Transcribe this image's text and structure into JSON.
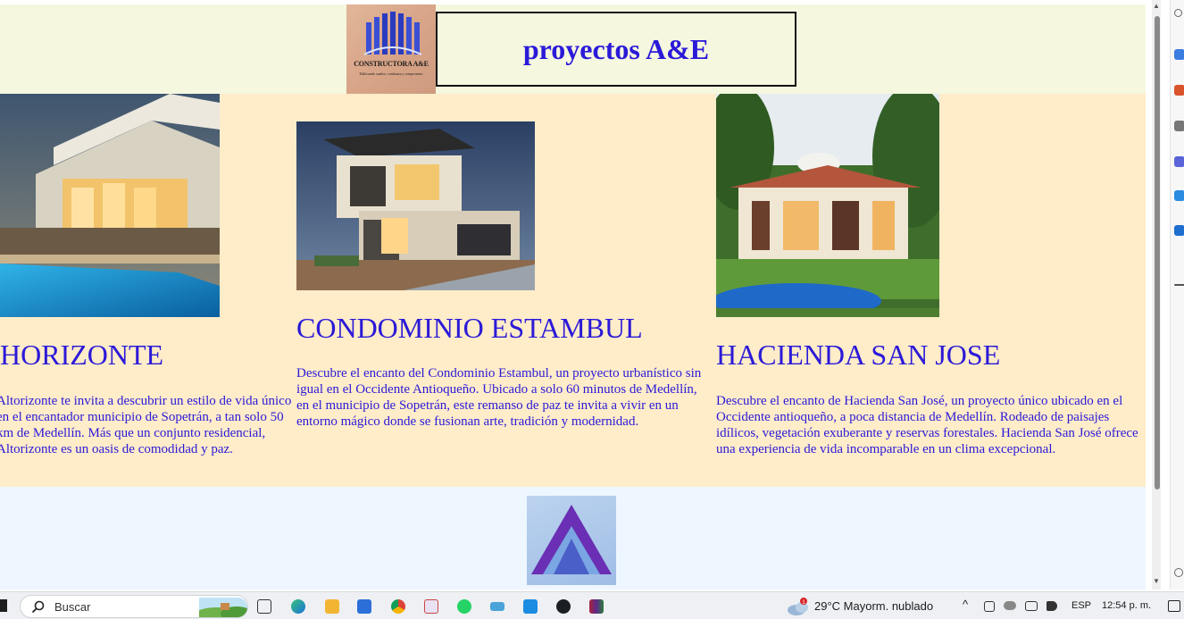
{
  "header": {
    "logo_name": "CONSTRUCTORA A&E",
    "logo_tagline": "Edificando sueños, confianza y compromiso",
    "title": "proyectos A&E"
  },
  "projects": [
    {
      "name": "HORIZONTE",
      "description": "Altorizonte te invita a descubrir un estilo de vida único en el encantador municipio de Sopetrán, a tan solo 50 km de Medellín. Más que un conjunto residencial, Altorizonte es un oasis de comodidad y paz."
    },
    {
      "name": "CONDOMINIO ESTAMBUL",
      "description": "Descubre el encanto del Condominio Estambul, un proyecto urbanístico sin igual en el Occidente Antioqueño. Ubicado a solo 60 minutos de Medellín, en el municipio de Sopetrán, este remanso de paz te invita a vivir en un entorno mágico donde se fusionan arte, tradición y modernidad."
    },
    {
      "name": "HACIENDA SAN JOSE",
      "description": "Descubre el encanto de Hacienda San José, un proyecto único ubicado en el Occidente antioqueño, a poca distancia de Medellín. Rodeado de paisajes idílicos, vegetación exuberante y reservas forestales. Hacienda San José ofrece una experiencia de vida incomparable en un clima excepcional."
    }
  ],
  "taskbar": {
    "search_placeholder": "Buscar",
    "weather_badge": "1",
    "weather": "29°C  Mayorm. nublado",
    "language": "ESP",
    "time": "12:54 p. m."
  },
  "colors": {
    "heading_blue": "#2b1ad8",
    "header_bg": "#f5f7df",
    "projects_bg": "#ffecc9",
    "footer_bg": "#eef6ff"
  }
}
